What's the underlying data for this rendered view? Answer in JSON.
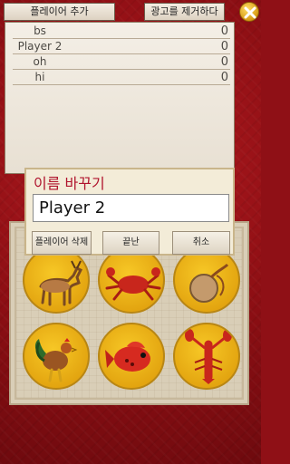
{
  "toolbar": {
    "add_player_label": "플레이어 추가",
    "remove_ads_label": "광고를 제거하다"
  },
  "players": [
    {
      "name": "bs",
      "score": "0"
    },
    {
      "name": "Player 2",
      "score": "0"
    },
    {
      "name": "oh",
      "score": "0"
    },
    {
      "name": "hi",
      "score": "0"
    }
  ],
  "dialog": {
    "title": "이름 바꾸기",
    "input_value": "Player 2",
    "delete_label": "플레이어 삭제",
    "done_label": "끝난",
    "cancel_label": "취소"
  },
  "board": {
    "symbols": [
      "deer-icon",
      "crab-icon",
      "gourd-icon",
      "rooster-icon",
      "fish-icon",
      "lobster-icon"
    ]
  },
  "colors": {
    "background": "#8f1016",
    "dialog_title": "#b0142d",
    "disc": "#f2bd1c",
    "close_button": "#e6a817"
  }
}
